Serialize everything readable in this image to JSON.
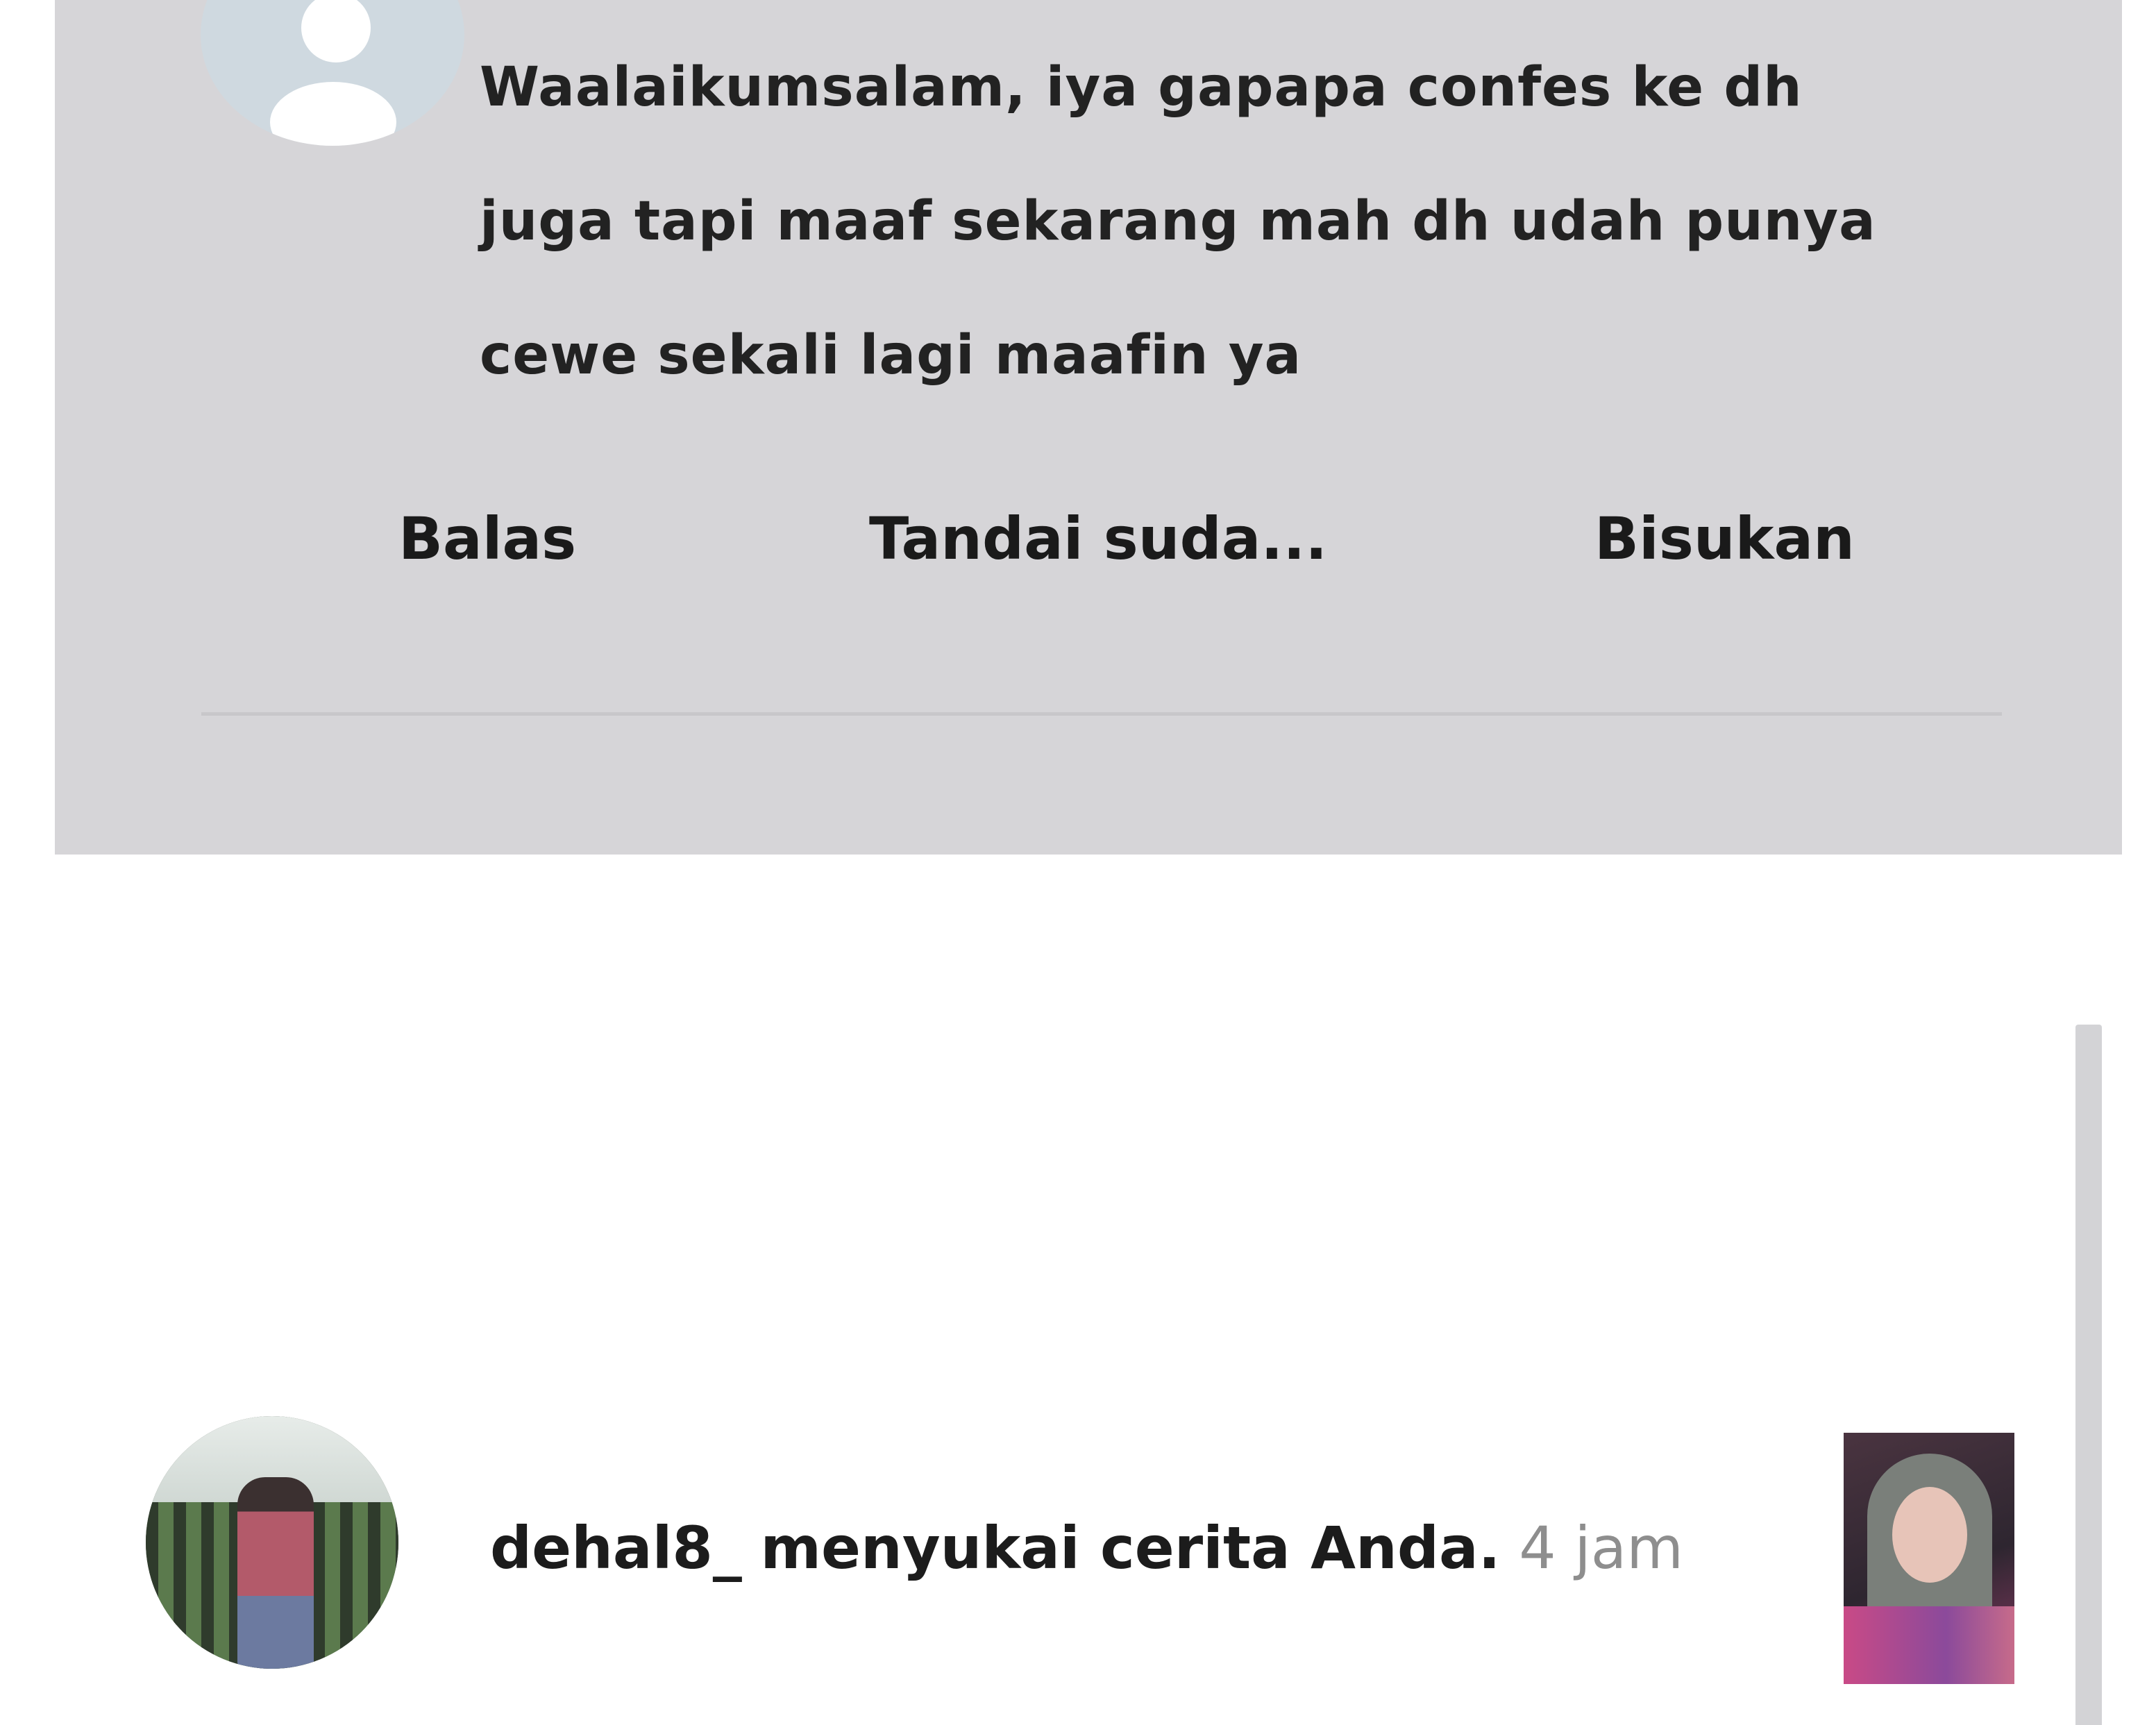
{
  "comment": {
    "avatar_icon": "default-user-icon",
    "text_lines": [
      "Waalaikumsalam, iya gapapa confes ke dh",
      "juga tapi maaf sekarang mah dh udah punya",
      "cewe sekali lagi maafin ya"
    ],
    "actions": {
      "reply": "Balas",
      "mark_read": "Tandai suda...",
      "mute": "Bisukan"
    },
    "colors": {
      "card_background": "#d6d5d8",
      "avatar_background": "#cfd9e0"
    }
  },
  "notification": {
    "username": "dehal8_",
    "message": "menyukai cerita Anda.",
    "time": "4 jam",
    "time_color": "#8e8e8e"
  }
}
